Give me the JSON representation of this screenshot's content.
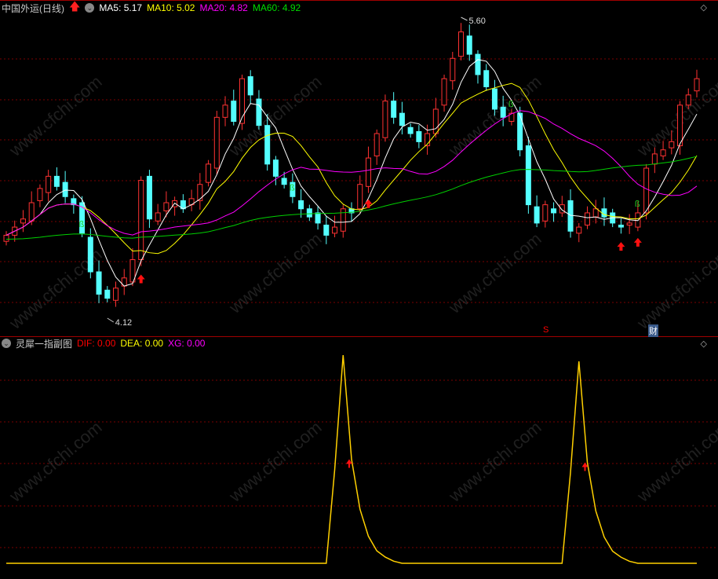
{
  "main_header": {
    "title": "中国外运(日线)",
    "ma5": "MA5: 5.17",
    "ma10": "MA10: 5.02",
    "ma20": "MA20: 4.82",
    "ma60": "MA60: 4.92"
  },
  "sub_header": {
    "title": "灵犀一指副图",
    "dif": "DIF: 0.00",
    "dea": "DEA: 0.00",
    "xg": "XG: 0.00"
  },
  "colors": {
    "up": "#ff3232",
    "down": "#54ffff",
    "ma5": "#ffffff",
    "ma10": "#ffff00",
    "ma20": "#ff00ff",
    "ma60": "#00d000",
    "grid": "#7a0000"
  },
  "watermark": "www.cfchi.com",
  "bottom_labels": {
    "s": "S",
    "cai": "财"
  },
  "chart_data": [
    {
      "type": "candlestick",
      "title": "中国外运(日线)",
      "ylim": [
        4.12,
        5.6
      ],
      "high_label": "5.60",
      "low_label": "4.12",
      "closes": [
        4.54,
        4.58,
        4.62,
        4.7,
        4.77,
        4.83,
        4.78,
        4.73,
        4.69,
        4.55,
        4.36,
        4.25,
        4.23,
        4.28,
        4.33,
        4.42,
        4.81,
        4.62,
        4.65,
        4.7,
        4.71,
        4.67,
        4.72,
        4.79,
        4.89,
        5.12,
        5.18,
        5.1,
        5.31,
        5.23,
        5.08,
        4.89,
        4.83,
        4.79,
        4.73,
        4.67,
        4.63,
        4.6,
        4.54,
        4.58,
        4.67,
        4.65,
        4.79,
        4.92,
        5.04,
        5.2,
        5.12,
        5.08,
        5.04,
        5.0,
        5.04,
        5.16,
        5.31,
        5.41,
        5.54,
        5.43,
        5.33,
        5.27,
        5.16,
        5.12,
        5.14,
        4.96,
        4.69,
        4.6,
        4.69,
        4.65,
        4.69,
        4.56,
        4.58,
        4.65,
        4.67,
        4.63,
        4.6,
        4.58,
        4.6,
        4.65,
        4.87,
        4.94,
        4.96,
        5.0,
        5.18,
        5.23,
        5.31
      ],
      "ma_periods": [
        5,
        10,
        20,
        60
      ],
      "buy_arrows": [
        16,
        43,
        73,
        75
      ],
      "b_signals": [
        9,
        34,
        60,
        75
      ]
    },
    {
      "type": "line",
      "title": "灵犀一指副图",
      "series": [
        {
          "name": "XG",
          "spikes": [
            {
              "index": 40,
              "peak": 100
            },
            {
              "index": 68,
              "peak": 97
            }
          ]
        }
      ],
      "arrows": [
        41,
        69
      ]
    }
  ]
}
